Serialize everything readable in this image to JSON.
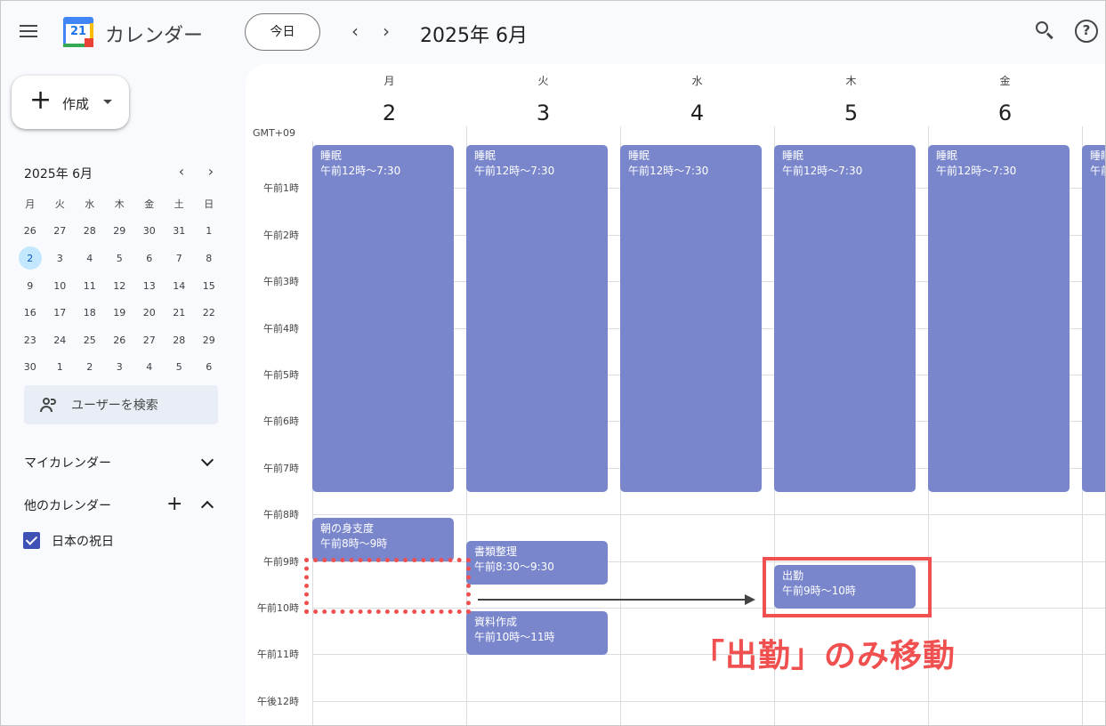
{
  "header": {
    "app_title": "カレンダー",
    "logo_day": "21",
    "today_label": "今日",
    "prev_arrow": "‹",
    "next_arrow": "›",
    "current_period": "2025年 6月",
    "help_glyph": "?"
  },
  "sidebar": {
    "create_label": "作成",
    "create_plus": "+",
    "mini_calendar": {
      "title": "2025年 6月",
      "prev": "‹",
      "next": "›",
      "weekdays": [
        "月",
        "火",
        "水",
        "木",
        "金",
        "土",
        "日"
      ],
      "weeks": [
        [
          "26",
          "27",
          "28",
          "29",
          "30",
          "31",
          "1"
        ],
        [
          "2",
          "3",
          "4",
          "5",
          "6",
          "7",
          "8"
        ],
        [
          "9",
          "10",
          "11",
          "12",
          "13",
          "14",
          "15"
        ],
        [
          "16",
          "17",
          "18",
          "19",
          "20",
          "21",
          "22"
        ],
        [
          "23",
          "24",
          "25",
          "26",
          "27",
          "28",
          "29"
        ],
        [
          "30",
          "1",
          "2",
          "3",
          "4",
          "5",
          "6"
        ]
      ],
      "selected": "2"
    },
    "user_search_label": "ユーザーを検索",
    "my_calendars_label": "マイカレンダー",
    "other_calendars_label": "他のカレンダー",
    "add_glyph": "+",
    "other_calendar_item": "日本の祝日"
  },
  "week": {
    "timezone": "GMT+09",
    "days": [
      {
        "dow": "月",
        "num": "2"
      },
      {
        "dow": "火",
        "num": "3"
      },
      {
        "dow": "水",
        "num": "4"
      },
      {
        "dow": "木",
        "num": "5"
      },
      {
        "dow": "金",
        "num": "6"
      }
    ],
    "hour_labels": [
      "午前1時",
      "午前2時",
      "午前3時",
      "午前4時",
      "午前5時",
      "午前6時",
      "午前7時",
      "午前8時",
      "午前9時",
      "午前10時",
      "午前11時",
      "午後12時"
    ]
  },
  "events": [
    {
      "title": "睡眠",
      "time": "午前12時〜7:30",
      "day": 0,
      "start": 0,
      "end": 7.5
    },
    {
      "title": "睡眠",
      "time": "午前12時〜7:30",
      "day": 1,
      "start": 0,
      "end": 7.5
    },
    {
      "title": "睡眠",
      "time": "午前12時〜7:30",
      "day": 2,
      "start": 0,
      "end": 7.5
    },
    {
      "title": "睡眠",
      "time": "午前12時〜7:30",
      "day": 3,
      "start": 0,
      "end": 7.5
    },
    {
      "title": "睡眠",
      "time": "午前12時〜7:30",
      "day": 4,
      "start": 0,
      "end": 7.5
    },
    {
      "title": "睡眠",
      "time": "午前",
      "day": 5,
      "start": 0,
      "end": 7.5
    },
    {
      "title": "朝の身支度",
      "time": "午前8時〜9時",
      "day": 0,
      "start": 8,
      "end": 9
    },
    {
      "title": "書類整理",
      "time": "午前8:30〜9:30",
      "day": 1,
      "start": 8.5,
      "end": 9.5
    },
    {
      "title": "出勤",
      "time": "午前9時〜10時",
      "day": 3,
      "start": 9,
      "end": 10
    },
    {
      "title": "資料作成",
      "time": "午前10時〜11時",
      "day": 1,
      "start": 10,
      "end": 11
    }
  ],
  "annotation": {
    "callout": "「出勤」のみ移動",
    "accent_color": "#f0504f"
  },
  "colors": {
    "event": "#7986cb",
    "selected_day": "#c2e7ff",
    "checkbox": "#3f51b5"
  }
}
